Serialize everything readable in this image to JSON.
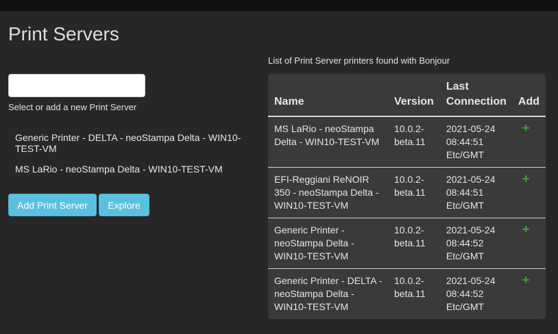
{
  "page": {
    "title": "Print Servers"
  },
  "left": {
    "input_value": "",
    "help_text": "Select or add a new Print Server",
    "servers": [
      "Generic Printer - DELTA - neoStampa Delta - WIN10-TEST-VM",
      "MS LaRio - neoStampa Delta - WIN10-TEST-VM"
    ],
    "add_button": "Add Print Server",
    "explore_button": "Explore"
  },
  "table": {
    "caption": "List of Print Server printers found with Bonjour",
    "headers": {
      "name": "Name",
      "version": "Version",
      "last_connection": "Last Connection",
      "add": "Add"
    },
    "rows": [
      {
        "name": "MS LaRio - neoStampa Delta - WIN10-TEST-VM",
        "version": "10.0.2-beta.11",
        "last": "2021-05-24 08:44:51 Etc/GMT",
        "add_icon": "+"
      },
      {
        "name": "EFI-Reggiani ReNOIR 350 - neoStampa Delta - WIN10-TEST-VM",
        "version": "10.0.2-beta.11",
        "last": "2021-05-24 08:44:51 Etc/GMT",
        "add_icon": "+"
      },
      {
        "name": "Generic Printer - neoStampa Delta - WIN10-TEST-VM",
        "version": "10.0.2-beta.11",
        "last": "2021-05-24 08:44:52 Etc/GMT",
        "add_icon": "+"
      },
      {
        "name": "Generic Printer - DELTA - neoStampa Delta - WIN10-TEST-VM",
        "version": "10.0.2-beta.11",
        "last": "2021-05-24 08:44:52 Etc/GMT",
        "add_icon": "+"
      }
    ]
  },
  "colors": {
    "background": "#272727",
    "button": "#5bc0de",
    "add_icon": "#3aa63a",
    "table_bg": "#3a3a3a"
  },
  "icons": {
    "add": "plus-icon"
  }
}
